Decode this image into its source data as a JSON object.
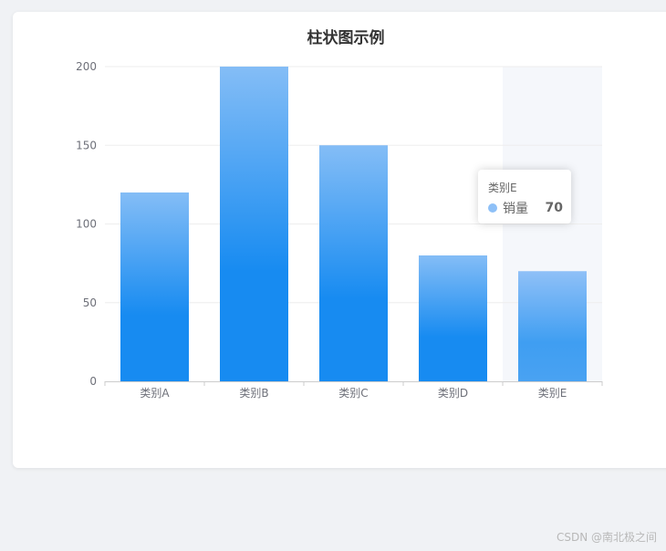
{
  "chart_data": {
    "type": "bar",
    "title": "柱状图示例",
    "categories": [
      "类别A",
      "类别B",
      "类别C",
      "类别D",
      "类别E"
    ],
    "series": [
      {
        "name": "销量",
        "values": [
          120,
          200,
          150,
          80,
          70
        ]
      }
    ],
    "ylim": [
      0,
      200
    ],
    "yticks": [
      0,
      50,
      100,
      150,
      200
    ],
    "xlabel": "",
    "ylabel": "",
    "grid": true,
    "highlighted_category": "类别E"
  },
  "tooltip": {
    "category": "类别E",
    "series_name": "销量",
    "value": "70"
  },
  "colors": {
    "bar_top": "#84bdf6",
    "bar_bottom": "#178bf1",
    "axis_pointer_bg": "#f5f7fb",
    "grid": "#eeeeee",
    "axis": "#cccccc"
  },
  "watermark": "CSDN @南北极之间"
}
